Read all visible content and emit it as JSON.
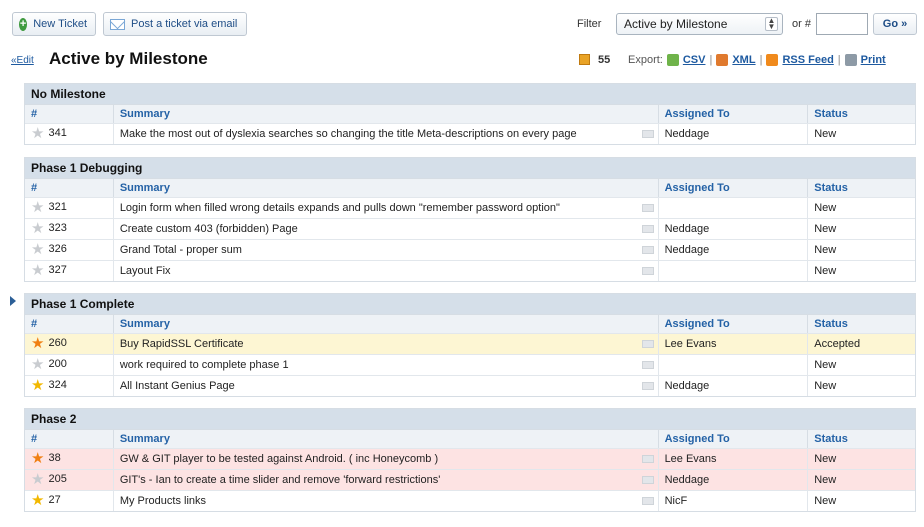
{
  "toolbar": {
    "new_ticket": "New Ticket",
    "post_email": "Post a ticket via email",
    "filter_label": "Filter",
    "filter_value": "Active by Milestone",
    "or_label": "or #",
    "go_label": "Go »"
  },
  "heading": {
    "edit_link": "«Edit",
    "title": "Active by Milestone",
    "count": "55",
    "export_label": "Export:",
    "csv": "CSV",
    "xml": "XML",
    "rss": "RSS Feed",
    "print": "Print"
  },
  "columns": {
    "num": "#",
    "summary": "Summary",
    "assigned": "Assigned To",
    "status": "Status"
  },
  "groups": [
    {
      "title": "No Milestone",
      "rows": [
        {
          "id": "341",
          "star": "grey",
          "summary": "Make the most out of dyslexia searches so changing the title Meta-descriptions on every page",
          "assigned": "Neddage",
          "status": "New"
        }
      ]
    },
    {
      "title": "Phase 1 Debugging",
      "rows": [
        {
          "id": "321",
          "star": "grey",
          "summary": "Login form when filled wrong details expands and pulls down \"remember password option\"",
          "assigned": "",
          "status": "New"
        },
        {
          "id": "323",
          "star": "grey",
          "summary": "Create custom 403 (forbidden) Page",
          "assigned": "Neddage",
          "status": "New"
        },
        {
          "id": "326",
          "star": "grey",
          "summary": "Grand Total - proper sum",
          "assigned": "Neddage",
          "status": "New"
        },
        {
          "id": "327",
          "star": "grey",
          "summary": "Layout Fix",
          "assigned": "",
          "status": "New"
        }
      ]
    },
    {
      "title": "Phase 1 Complete",
      "rows": [
        {
          "id": "260",
          "star": "orange",
          "summary": "Buy RapidSSL Certificate",
          "assigned": "Lee Evans",
          "status": "Accepted"
        },
        {
          "id": "200",
          "star": "grey",
          "summary": "work required to complete phase 1",
          "assigned": "",
          "status": "New"
        },
        {
          "id": "324",
          "star": "gold",
          "summary": "All Instant Genius Page",
          "assigned": "Neddage",
          "status": "New"
        }
      ]
    },
    {
      "title": "Phase 2",
      "rows": [
        {
          "id": "38",
          "star": "orange",
          "summary": "GW & GIT player to be tested against Android. ( inc Honeycomb )",
          "assigned": "Lee Evans",
          "status": "New"
        },
        {
          "id": "205",
          "star": "grey",
          "summary": "GIT's - Ian to create a time slider and remove 'forward restrictions'",
          "assigned": "Neddage",
          "status": "New"
        },
        {
          "id": "27",
          "star": "gold",
          "summary": "My Products links",
          "assigned": "NicF",
          "status": "New"
        }
      ]
    }
  ],
  "colors": {
    "accent": "#2462a6",
    "group_header": "#d5dfe9",
    "row_highlight_yellow": "#fdf6d3",
    "row_highlight_red": "#fde3e3"
  }
}
